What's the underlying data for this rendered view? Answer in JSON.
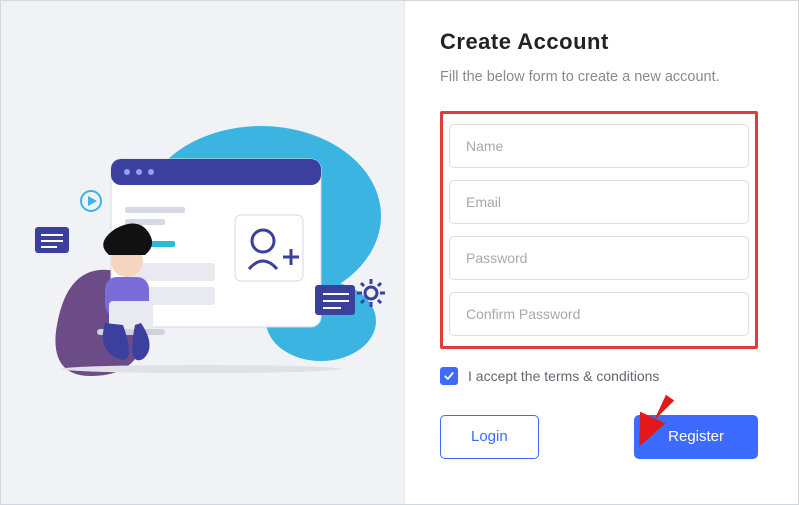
{
  "heading": "Create Account",
  "subtitle": "Fill the below form to create a new account.",
  "fields": {
    "name_ph": "Name",
    "email_ph": "Email",
    "password_ph": "Password",
    "confirm_ph": "Confirm Password"
  },
  "terms": {
    "checked": true,
    "label": "I accept the terms & conditions"
  },
  "buttons": {
    "login": "Login",
    "register": "Register"
  },
  "colors": {
    "primary": "#3d6bff",
    "highlight_box": "#e23b3b",
    "arrow": "#e31919"
  }
}
